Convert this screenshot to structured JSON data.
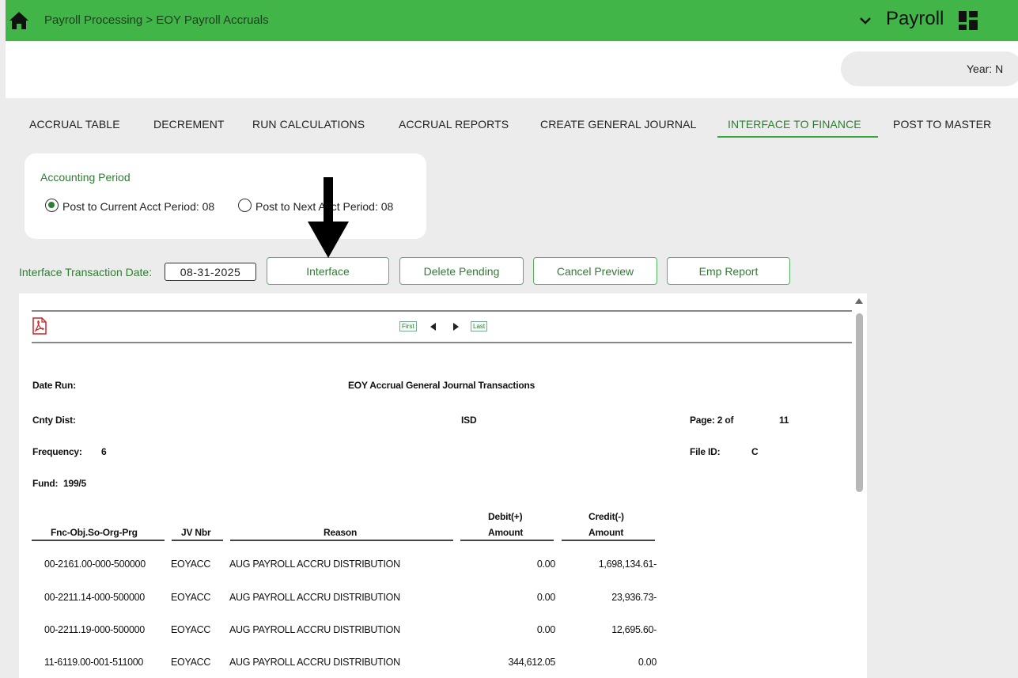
{
  "topbar": {
    "breadcrumb": "Payroll Processing > EOY Payroll Accruals",
    "app_title": "Payroll"
  },
  "header": {
    "year_label": "Year: N"
  },
  "tabs": [
    {
      "label": "ACCRUAL TABLE"
    },
    {
      "label": "DECREMENT"
    },
    {
      "label": "RUN CALCULATIONS"
    },
    {
      "label": "ACCRUAL REPORTS"
    },
    {
      "label": "CREATE GENERAL JOURNAL"
    },
    {
      "label": "INTERFACE TO FINANCE",
      "active": true
    },
    {
      "label": "POST TO MASTER"
    }
  ],
  "accounting_period": {
    "title": "Accounting Period",
    "options": [
      {
        "label": "Post to Current Acct Period: 08",
        "selected": true
      },
      {
        "label": "Post to Next Acct Period: 08",
        "selected": false
      }
    ]
  },
  "interface": {
    "date_label": "Interface Transaction Date:",
    "date_value": "08-31-2025",
    "buttons": {
      "interface": "Interface",
      "delete_pending": "Delete Pending",
      "cancel_preview": "Cancel Preview",
      "emp_report": "Emp Report"
    }
  },
  "viewer": {
    "first": "First",
    "last": "Last"
  },
  "report": {
    "date_run_label": "Date Run:",
    "title": "EOY Accrual General Journal Transactions",
    "cnty_dist_label": "Cnty Dist:",
    "org_type": "ISD",
    "page_label": "Page: 2 of",
    "page_total": "11",
    "frequency_label": "Frequency:",
    "frequency_value": "6",
    "file_id_label": "File ID:",
    "file_id_value": "C",
    "fund_label": "Fund:",
    "fund_value": "199/5",
    "columns": {
      "account": "Fnc-Obj.So-Org-Prg",
      "jv": "JV Nbr",
      "reason": "Reason",
      "debit_top": "Debit(+)",
      "debit_bottom": "Amount",
      "credit_top": "Credit(-)",
      "credit_bottom": "Amount"
    },
    "rows": [
      {
        "account": "00-2161.00-000-500000",
        "jv": "EOYACC",
        "reason": "AUG PAYROLL ACCRU DISTRIBUTION",
        "debit": "0.00",
        "credit": "1,698,134.61-"
      },
      {
        "account": "00-2211.14-000-500000",
        "jv": "EOYACC",
        "reason": "AUG PAYROLL ACCRU DISTRIBUTION",
        "debit": "0.00",
        "credit": "23,936.73-"
      },
      {
        "account": "00-2211.19-000-500000",
        "jv": "EOYACC",
        "reason": "AUG PAYROLL ACCRU DISTRIBUTION",
        "debit": "0.00",
        "credit": "12,695.60-"
      },
      {
        "account": "11-6119.00-001-511000",
        "jv": "EOYACC",
        "reason": "AUG PAYROLL ACCRU DISTRIBUTION",
        "debit": "344,612.05",
        "credit": "0.00"
      }
    ]
  },
  "colors": {
    "brand_green": "#42b549",
    "accent_text": "#2e7d32"
  }
}
